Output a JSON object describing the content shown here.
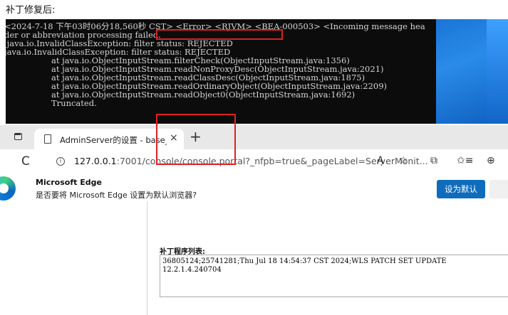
{
  "heading": "补丁修复后:",
  "console": {
    "lines": [
      "<2024-7-18 下午03时06分18,560秒 CST> <Error> <RJVM> <BEA-000503> <Incoming message hea",
      "der or abbreviation processing failed.",
      " java.io.InvalidClassException: filter status: REJECTED",
      "java.io.InvalidClassException: filter status: REJECTED",
      "at java.io.ObjectInputStream.filterCheck(ObjectInputStream.java:1356)",
      "at java.io.ObjectInputStream.readNonProxyDesc(ObjectInputStream.java:2021)",
      "at java.io.ObjectInputStream.readClassDesc(ObjectInputStream.java:1875)",
      "at java.io.ObjectInputStream.readOrdinaryObject(ObjectInputStream.java:2209)",
      "at java.io.ObjectInputStream.readObject0(ObjectInputStream.java:1692)",
      "Truncated."
    ]
  },
  "browser": {
    "tab_title": "AdminServer的设置 - base_doma",
    "tab_close": "×",
    "new_tab": "+",
    "reload": "C",
    "info": "i",
    "url_host": "127.0.0.1",
    "url_path": ":7001/console/console.portal?_nfpb=true&_pageLabel=ServerMonit...",
    "toolbar_icons": [
      "Aͅ",
      "☆",
      "⧉",
      "✩≡",
      "⊕"
    ]
  },
  "notice": {
    "title": "Microsoft Edge",
    "text": "是否要将 Microsoft Edge 设置为默认浏览器?",
    "button": "设为默认"
  },
  "patch": {
    "label": "补丁程序列表:",
    "lines": [
      "36805124;25741281;Thu Jul 18 14:54:37 CST 2024;WLS PATCH SET UPDATE",
      "12.2.1.4.240704"
    ]
  },
  "colors": {
    "highlight": "#e02020",
    "console_bg": "#0c0c0c",
    "edge_button": "#0f6cbd"
  }
}
